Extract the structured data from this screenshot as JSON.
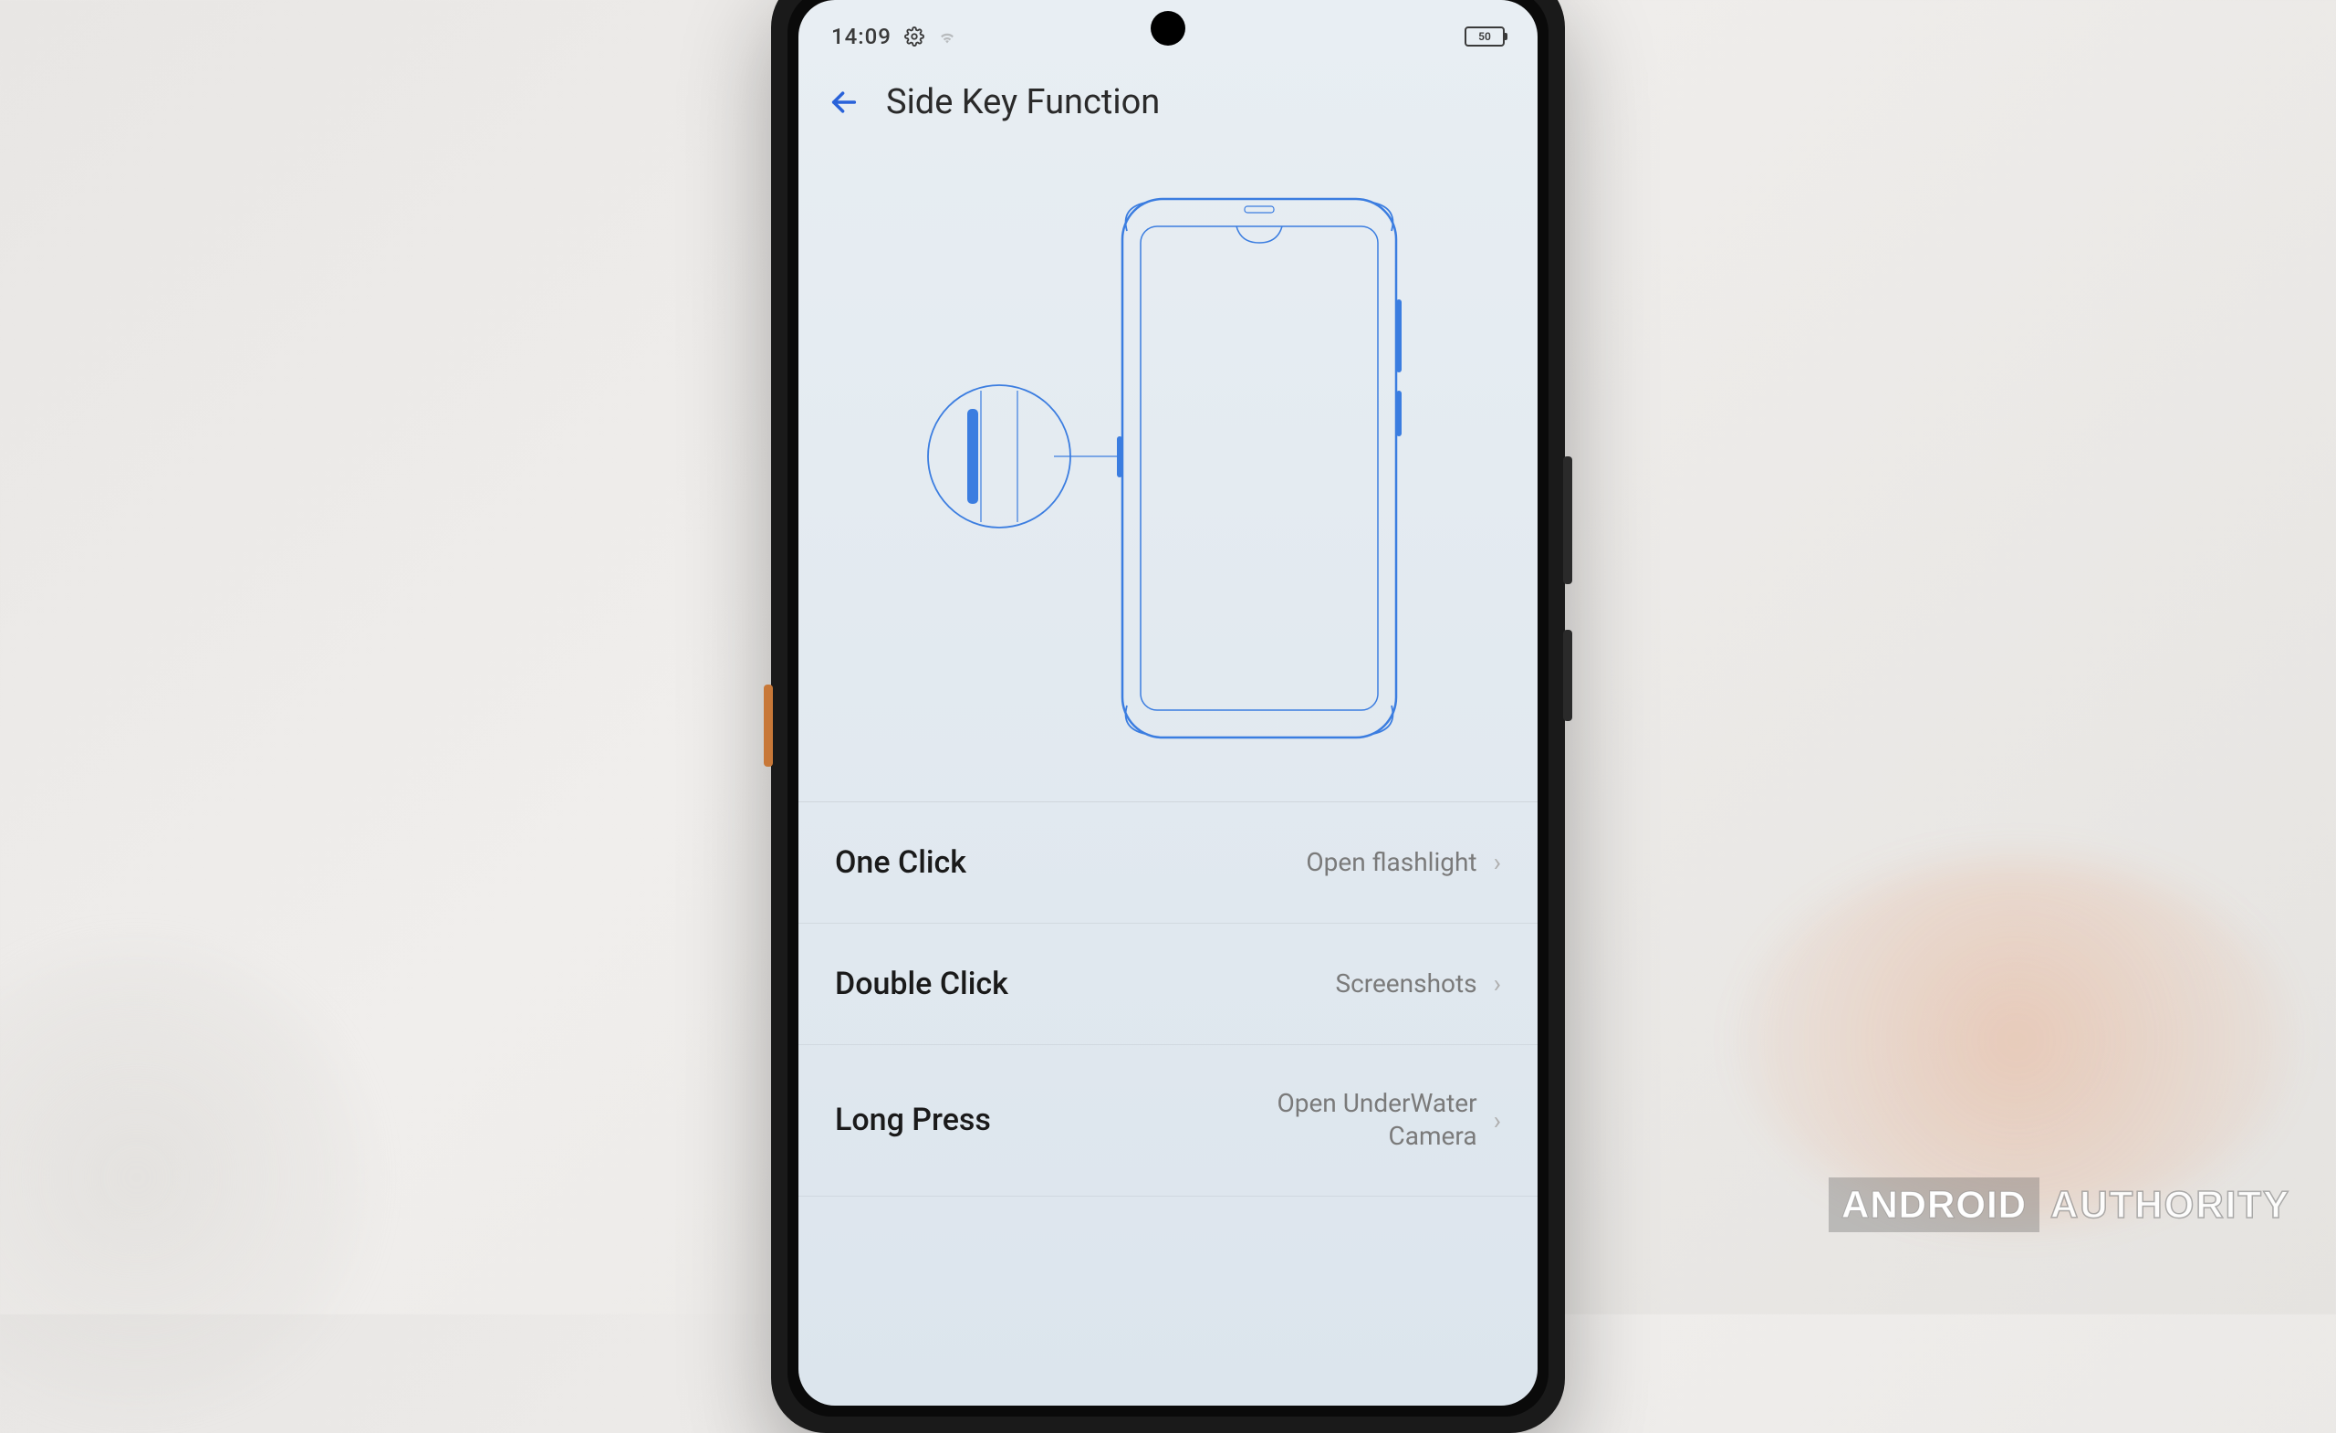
{
  "status_bar": {
    "time": "14:09",
    "battery_label": "50"
  },
  "header": {
    "title": "Side Key Function"
  },
  "settings": [
    {
      "label": "One Click",
      "value": "Open flashlight"
    },
    {
      "label": "Double Click",
      "value": "Screenshots"
    },
    {
      "label": "Long Press",
      "value": "Open UnderWater Camera"
    }
  ],
  "watermark": {
    "first": "ANDROID",
    "second": "AUTHORITY"
  }
}
